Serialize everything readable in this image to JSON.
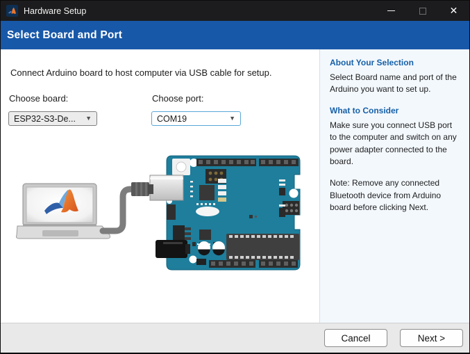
{
  "window": {
    "title": "Hardware Setup"
  },
  "icons": {
    "minimize_glyph": "",
    "close_glyph": "✕",
    "dropdown_arrow": "▼"
  },
  "banner": {
    "title": "Select Board and Port"
  },
  "main": {
    "instruction": "Connect Arduino board to host computer via USB cable for setup.",
    "board_label": "Choose board:",
    "board_value": "ESP32-S3-De...",
    "port_label": "Choose port:",
    "port_value": "COM19"
  },
  "sidebar": {
    "about_heading": "About Your Selection",
    "about_body": "Select Board name and port of the Arduino you want to set up.",
    "consider_heading": "What to Consider",
    "consider_body": "Make sure you connect USB port to the computer and switch on any power adapter connected to the board.",
    "note_body": "Note: Remove any connected Bluetooth device from Arduino board before clicking Next."
  },
  "footer": {
    "cancel_label": "Cancel",
    "next_label": "Next >"
  },
  "colors": {
    "titlebar_bg": "#1c1c1e",
    "banner_bg": "#1858a8",
    "sidebar_bg": "#f3f8fd",
    "sidebar_heading": "#1660a8",
    "port_dropdown_border": "#5aa7d8",
    "board_teal": "#1e7e9c",
    "matlab_orange": "#e8762d"
  }
}
